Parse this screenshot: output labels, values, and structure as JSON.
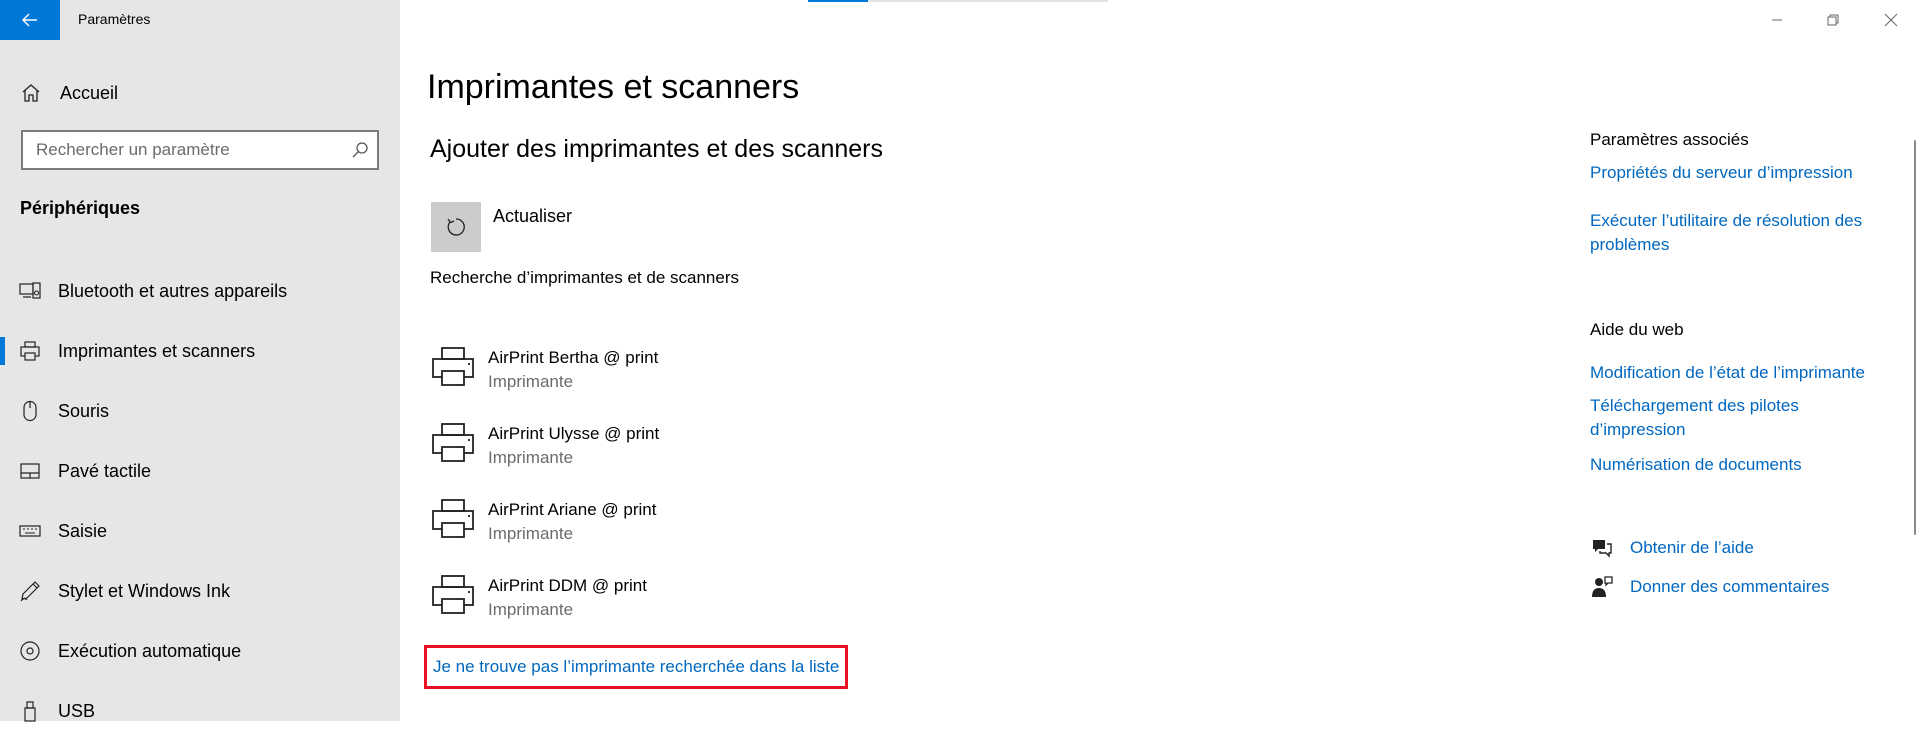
{
  "window": {
    "app_title": "Paramètres"
  },
  "sidebar": {
    "home_label": "Accueil",
    "search_placeholder": "Rechercher un paramètre",
    "section_heading": "Périphériques",
    "items": [
      {
        "label": "Bluetooth et autres appareils",
        "icon": "bluetooth-devices-icon"
      },
      {
        "label": "Imprimantes et scanners",
        "icon": "printer-icon",
        "selected": true
      },
      {
        "label": "Souris",
        "icon": "mouse-icon"
      },
      {
        "label": "Pavé tactile",
        "icon": "touchpad-icon"
      },
      {
        "label": "Saisie",
        "icon": "keyboard-icon"
      },
      {
        "label": "Stylet et Windows Ink",
        "icon": "pen-icon"
      },
      {
        "label": "Exécution automatique",
        "icon": "autoplay-icon"
      },
      {
        "label": "USB",
        "icon": "usb-icon"
      }
    ]
  },
  "main": {
    "title": "Imprimantes et scanners",
    "add_heading": "Ajouter des imprimantes et des scanners",
    "refresh_label": "Actualiser",
    "search_status": "Recherche d’imprimantes et de scanners",
    "printers": [
      {
        "name": "AirPrint Bertha @ print",
        "type": "Imprimante"
      },
      {
        "name": "AirPrint Ulysse @ print",
        "type": "Imprimante"
      },
      {
        "name": "AirPrint Ariane @ print",
        "type": "Imprimante"
      },
      {
        "name": "AirPrint DDM @ print",
        "type": "Imprimante"
      }
    ],
    "not_listed_link": "Je ne trouve pas l’imprimante recherchée dans la liste"
  },
  "related": {
    "heading": "Paramètres associés",
    "links": [
      "Propriétés du serveur d’impression",
      "Exécuter l’utilitaire de résolution des problèmes"
    ]
  },
  "web_help": {
    "heading": "Aide du web",
    "links": [
      "Modification de l’état de l’imprimante",
      "Téléchargement des pilotes d’impression",
      "Numérisation de documents"
    ]
  },
  "support": {
    "get_help": "Obtenir de l’aide",
    "feedback": "Donner des commentaires"
  },
  "colors": {
    "accent": "#0078d7",
    "link": "#0067c0",
    "highlight_border": "#e81123",
    "sidebar_bg": "#e6e6e6"
  }
}
